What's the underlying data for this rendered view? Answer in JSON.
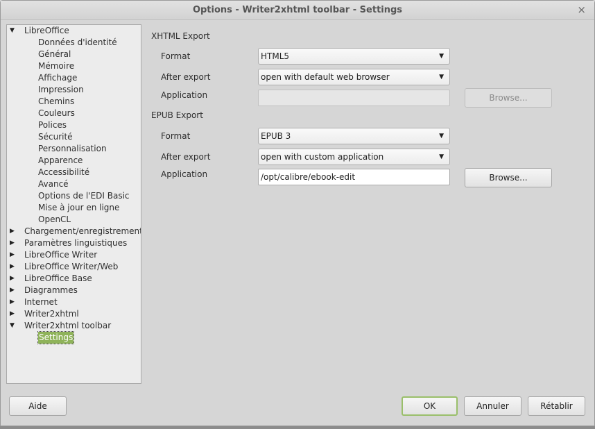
{
  "window": {
    "title": "Options - Writer2xhtml toolbar - Settings",
    "close_glyph": "×"
  },
  "tree": {
    "items": [
      {
        "label": "LibreOffice",
        "level": 0,
        "expanded": true
      },
      {
        "label": "Données d'identité",
        "level": 1
      },
      {
        "label": "Général",
        "level": 1
      },
      {
        "label": "Mémoire",
        "level": 1
      },
      {
        "label": "Affichage",
        "level": 1
      },
      {
        "label": "Impression",
        "level": 1
      },
      {
        "label": "Chemins",
        "level": 1
      },
      {
        "label": "Couleurs",
        "level": 1
      },
      {
        "label": "Polices",
        "level": 1
      },
      {
        "label": "Sécurité",
        "level": 1
      },
      {
        "label": "Personnalisation",
        "level": 1
      },
      {
        "label": "Apparence",
        "level": 1
      },
      {
        "label": "Accessibilité",
        "level": 1
      },
      {
        "label": "Avancé",
        "level": 1
      },
      {
        "label": "Options de l'EDI Basic",
        "level": 1
      },
      {
        "label": "Mise à jour en ligne",
        "level": 1
      },
      {
        "label": "OpenCL",
        "level": 1
      },
      {
        "label": "Chargement/enregistrement",
        "level": 0,
        "expanded": false
      },
      {
        "label": "Paramètres linguistiques",
        "level": 0,
        "expanded": false
      },
      {
        "label": "LibreOffice Writer",
        "level": 0,
        "expanded": false
      },
      {
        "label": "LibreOffice Writer/Web",
        "level": 0,
        "expanded": false
      },
      {
        "label": "LibreOffice Base",
        "level": 0,
        "expanded": false
      },
      {
        "label": "Diagrammes",
        "level": 0,
        "expanded": false
      },
      {
        "label": "Internet",
        "level": 0,
        "expanded": false
      },
      {
        "label": "Writer2xhtml",
        "level": 0,
        "expanded": false
      },
      {
        "label": "Writer2xhtml toolbar",
        "level": 0,
        "expanded": true
      },
      {
        "label": "Settings",
        "level": 1,
        "selected": true
      }
    ]
  },
  "xhtml": {
    "section_title": "XHTML Export",
    "format_label": "Format",
    "format_value": "HTML5",
    "after_export_label": "After export",
    "after_export_value": "open with default web browser",
    "application_label": "Application",
    "application_value": "",
    "browse_label": "Browse..."
  },
  "epub": {
    "section_title": "EPUB Export",
    "format_label": "Format",
    "format_value": "EPUB 3",
    "after_export_label": "After export",
    "after_export_value": "open with custom application",
    "application_label": "Application",
    "application_value": "/opt/calibre/ebook-edit",
    "browse_label": "Browse..."
  },
  "buttons": {
    "help": "Aide",
    "ok": "OK",
    "cancel": "Annuler",
    "reset": "Rétablir"
  },
  "colors": {
    "selection": "#8fb35a",
    "default_button_border": "#9abf6a"
  }
}
